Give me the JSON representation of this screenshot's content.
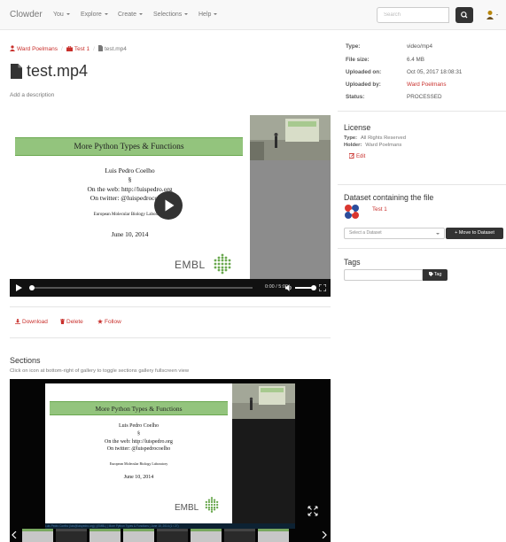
{
  "navbar": {
    "brand": "Clowder",
    "menus": [
      "You",
      "Explore",
      "Create",
      "Selections",
      "Help"
    ],
    "search_placeholder": "Search"
  },
  "breadcrumb": {
    "user": "Ward Poelmans",
    "dataset": "Test 1",
    "file": "test.mp4"
  },
  "file": {
    "title": "test.mp4",
    "add_description": "Add a description"
  },
  "video": {
    "slide_title": "More Python Types & Functions",
    "author": "Luis Pedro Coelho",
    "section_mark": "§",
    "web": "On the web: http://luispedro.org",
    "twitter": "On twitter: @luispedrocoelho",
    "institution": "European Molecular Biology Laboratory",
    "date": "June 10, 2014",
    "logo_text": "EMBL",
    "time": "0:00 / 5:00",
    "progress": 0.0
  },
  "actions": {
    "download": "Download",
    "delete": "Delete",
    "follow": "Follow"
  },
  "sections": {
    "heading": "Sections",
    "note": "Click on icon at bottom-right of gallery to toggle sections gallery fullscreen view",
    "caption": "Luis Pedro Coelho (luis@luispedro.org) | (EMBL) | More Python Types & Functions | June 10, 2014 (1 / 27)"
  },
  "info": {
    "type_label": "Type:",
    "type_value": "video/mp4",
    "size_label": "File size:",
    "size_value": "6.4 MB",
    "uploaded_on_label": "Uploaded on:",
    "uploaded_on_value": "Oct 05, 2017 18:08:31",
    "uploaded_by_label": "Uploaded by:",
    "uploaded_by_value": "Ward Poelmans",
    "status_label": "Status:",
    "status_value": "PROCESSED"
  },
  "license": {
    "heading": "License",
    "type_label": "Type:",
    "type_value": "All Rights Reserved",
    "holder_label": "Holder:",
    "holder_value": "Ward Poelmans",
    "edit": "Edit"
  },
  "dataset": {
    "heading": "Dataset containing the file",
    "name": "Test 1",
    "select_placeholder": "Select a Dataset",
    "move_button": "Move to Dataset"
  },
  "tags": {
    "heading": "Tags",
    "button": "Tag"
  },
  "colors": {
    "accent": "#c9302c",
    "navbar": "#f8f8f8",
    "dark_button": "#333333",
    "slide_green": "#93c47d"
  }
}
